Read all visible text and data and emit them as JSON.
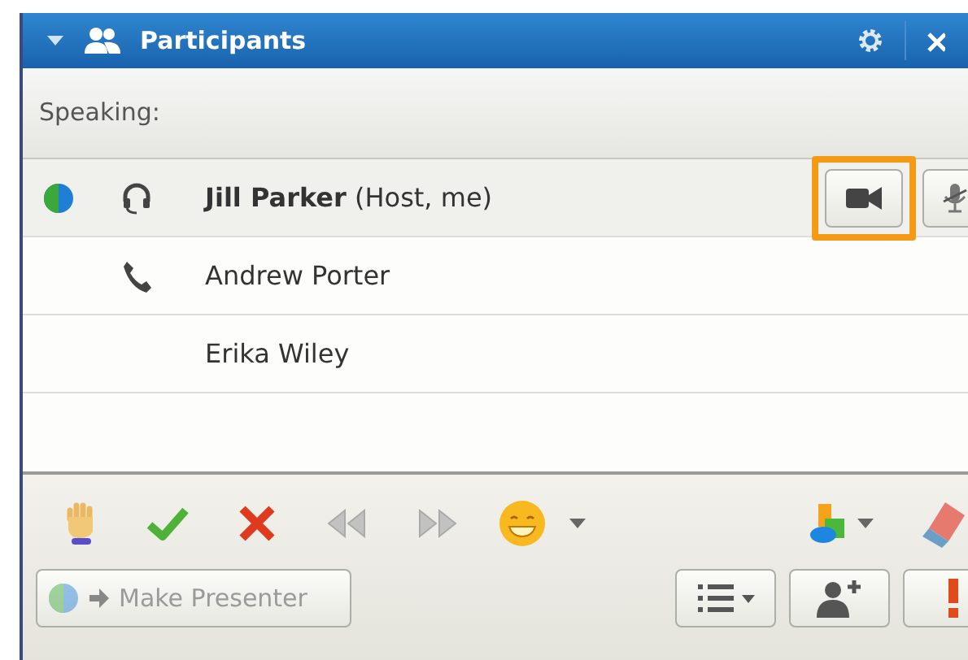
{
  "panel": {
    "title": "Participants",
    "expanded": true
  },
  "speaking_label": "Speaking:",
  "participants": [
    {
      "name": "**Jill Parker** (Host, me)",
      "presenter": true,
      "kind": "headset",
      "controls": true,
      "video_highlighted": true
    },
    {
      "name": "Andrew Porter",
      "presenter": false,
      "kind": "phone",
      "controls": false
    },
    {
      "name": "Erika Wiley",
      "presenter": false,
      "kind": "none",
      "controls": false
    }
  ],
  "make_presenter": {
    "label": "Make Presenter",
    "disabled": true
  }
}
